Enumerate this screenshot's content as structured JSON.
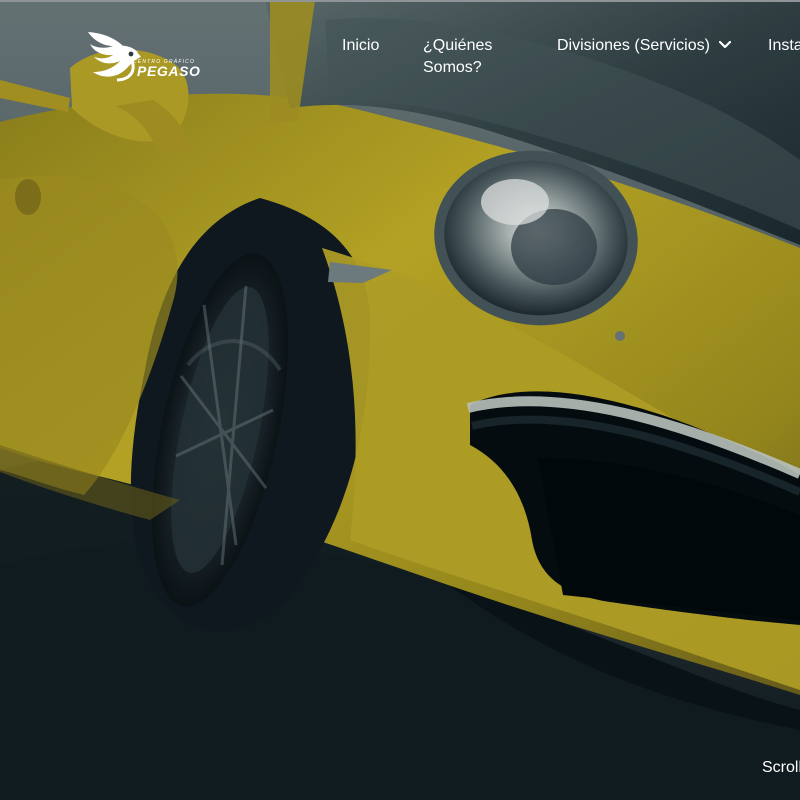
{
  "logo": {
    "tagline": "CENTRO GRÁFICO",
    "name": "PEGASO"
  },
  "nav": {
    "items": [
      {
        "label": "Inicio"
      },
      {
        "label": "¿Quiénes Somos?"
      },
      {
        "label": "Divisiones (Servicios)",
        "icon": "chevron-down-icon"
      },
      {
        "label": "Instalaciones"
      }
    ]
  },
  "hero": {
    "scroll_label": "Scroll"
  },
  "colors": {
    "car_yellow": "#c9b12a",
    "text": "#ffffff",
    "road_dark": "#111b20"
  }
}
